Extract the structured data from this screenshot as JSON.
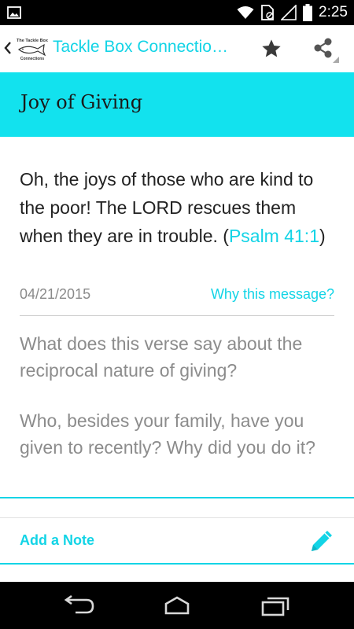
{
  "status_bar": {
    "time": "2:25",
    "icons": [
      "image-icon",
      "wifi-icon",
      "no-sim-icon",
      "signal-icon",
      "battery-icon"
    ]
  },
  "app_bar": {
    "logo_text": "The Tackle Box Connections",
    "title": "Tackle Box Connectio…",
    "icons": [
      "back-chevron-icon",
      "star-icon",
      "share-icon"
    ]
  },
  "header": {
    "title": "Joy of Giving"
  },
  "message": {
    "verse_text": "Oh, the joys of those who are kind to the poor! The LORD rescues them when they are in trouble. (",
    "verse_ref": "Psalm 41:1",
    "verse_close": ")",
    "date": "04/21/2015",
    "why_link": "Why this message?",
    "questions": [
      "What does this verse say about the reciprocal nature of giving?",
      "Who, besides your family, have you given to recently? Why did you do it?"
    ]
  },
  "note": {
    "label": "Add a Note",
    "icon": "pencil-icon"
  },
  "nav_bar": {
    "icons": [
      "nav-back-icon",
      "nav-home-icon",
      "nav-recents-icon"
    ]
  },
  "colors": {
    "accent": "#13d4e6",
    "header_band": "#12e2ee",
    "status_bar": "#000000",
    "nav_bar": "#000000"
  }
}
